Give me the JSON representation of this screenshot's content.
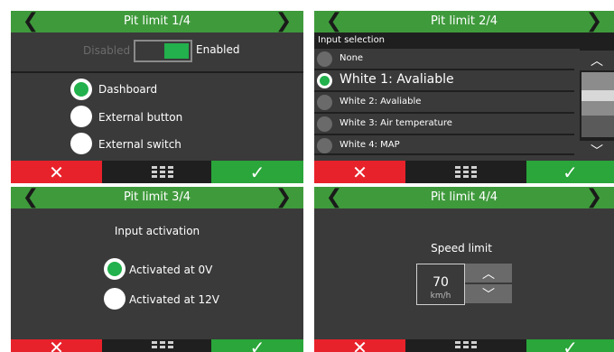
{
  "colors": {
    "header_green": "#3f9a3c",
    "confirm_green": "#2aa63a",
    "cancel_red": "#e8222b",
    "panel_bg": "#3a3a3a",
    "radio_selected": "#22b14c"
  },
  "icons": {
    "back": "chevron-left-icon",
    "forward": "chevron-right-icon",
    "cancel": "close-x-icon",
    "menu": "grid-menu-icon",
    "confirm": "checkmark-icon",
    "up": "chevron-up-icon",
    "down": "chevron-down-icon"
  },
  "nav": {
    "left": "❮",
    "right": "❯"
  },
  "glyphs": {
    "cancel": "✕",
    "confirm": "✓",
    "up": "︿",
    "down": "﹀"
  },
  "panel1": {
    "title": "Pit limit 1/4",
    "toggle": {
      "off_label": "Disabled",
      "on_label": "Enabled",
      "state": "Enabled"
    },
    "options": [
      {
        "label": "Dashboard",
        "selected": true
      },
      {
        "label": "External button",
        "selected": false
      },
      {
        "label": "External switch",
        "selected": false
      }
    ]
  },
  "panel2": {
    "title": "Pit limit 2/4",
    "subheader": "Input selection",
    "items": [
      {
        "label": "None",
        "selected": false
      },
      {
        "label": "White 1: Avaliable",
        "selected": true
      },
      {
        "label": "White 2: Avaliable",
        "selected": false
      },
      {
        "label": "White 3: Air temperature",
        "selected": false
      },
      {
        "label": "White 4: MAP",
        "selected": false
      }
    ]
  },
  "panel3": {
    "title": "Pit limit 3/4",
    "heading": "Input activation",
    "options": [
      {
        "label": "Activated at 0V",
        "selected": true
      },
      {
        "label": "Activated at 12V",
        "selected": false
      }
    ]
  },
  "panel4": {
    "title": "Pit limit 4/4",
    "label": "Speed limit",
    "value": "70",
    "unit": "km/h"
  }
}
